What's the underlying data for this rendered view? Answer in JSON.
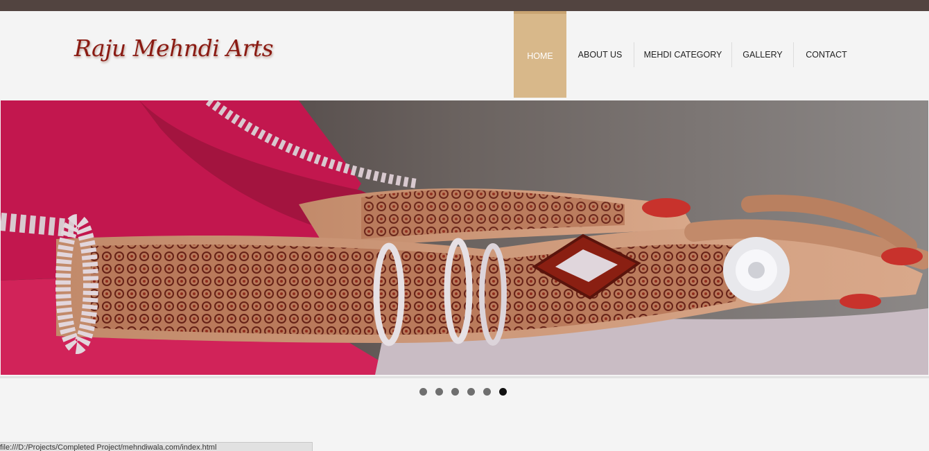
{
  "brand": {
    "logo_text": "Raju Mehndi Arts"
  },
  "nav": {
    "items": [
      {
        "label": "HOME",
        "active": true
      },
      {
        "label": "ABOUT US"
      },
      {
        "label": "MEHDI CATEGORY"
      },
      {
        "label": "GALLERY"
      },
      {
        "label": "CONTACT"
      }
    ]
  },
  "slider": {
    "image": "mehndi-hands-icon",
    "slide_count": 6,
    "active_slide": 6
  },
  "statusbar": {
    "url": "file:///D:/Projects/Completed Project/mehndiwala.com/index.html"
  },
  "colors": {
    "topbar": "#524440",
    "nav_active": "#d8b88a",
    "logo": "#8a1a12",
    "dot": "#6f6f6f",
    "dot_active": "#111111"
  }
}
